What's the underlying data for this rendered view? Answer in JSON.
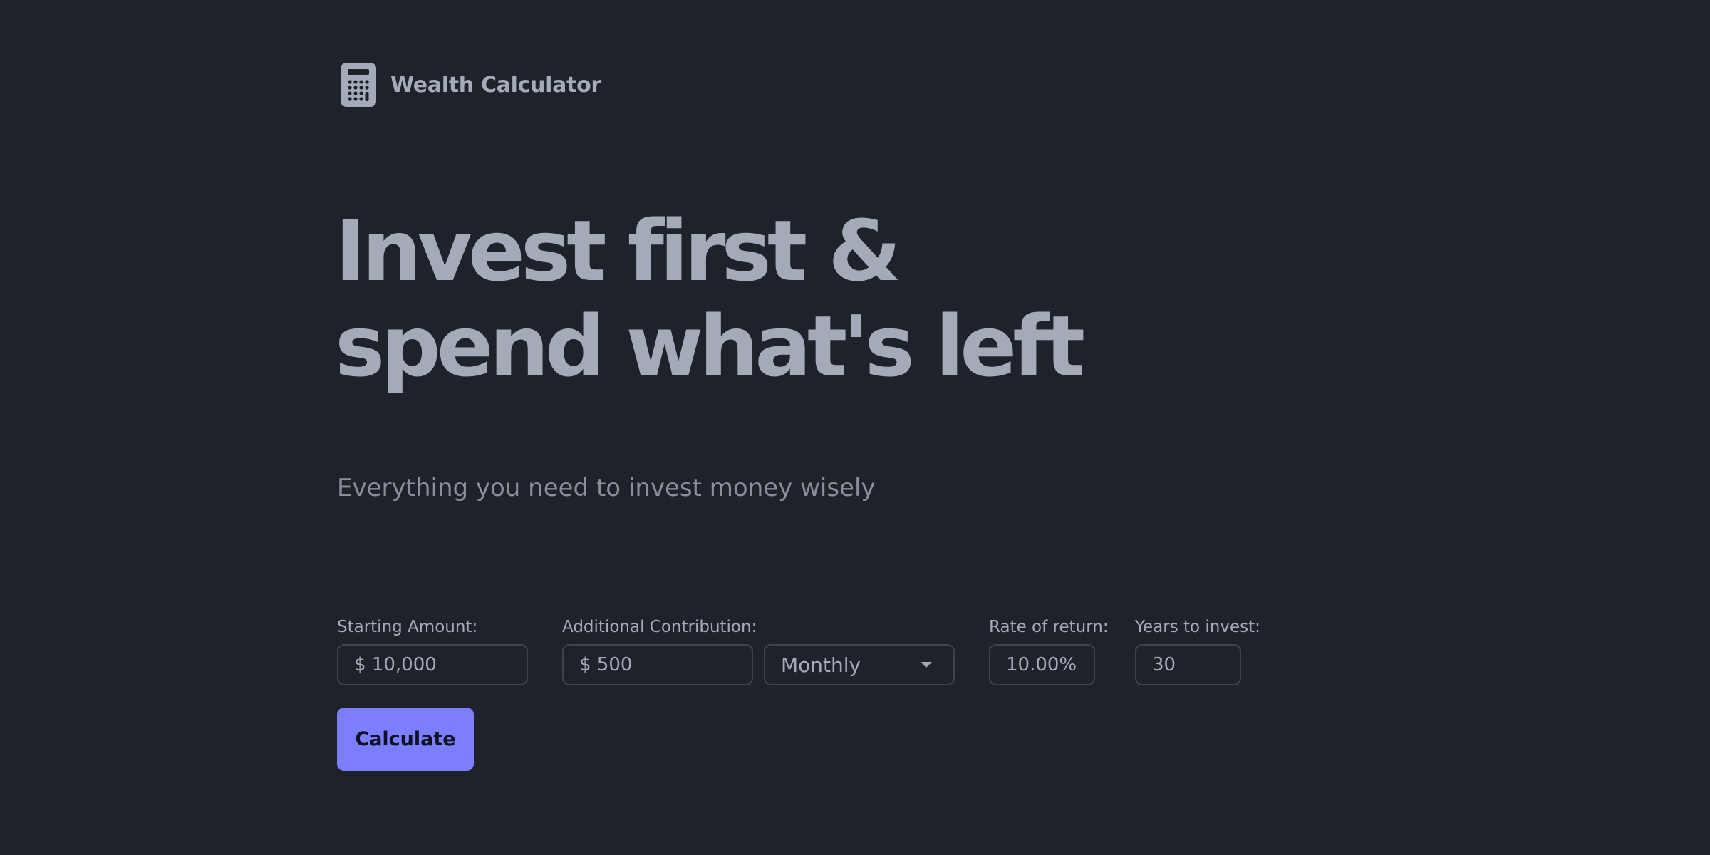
{
  "header": {
    "icon": "calculator-icon",
    "app_name": "Wealth Calculator"
  },
  "hero": {
    "headline_line1": "Invest first &",
    "headline_line2": "spend what's left",
    "subtitle": "Everything you need to invest money wisely"
  },
  "form": {
    "starting_amount": {
      "label": "Starting Amount:",
      "value": "$ 10,000"
    },
    "additional_contribution": {
      "label": "Additional Contribution:",
      "value": "$ 500"
    },
    "frequency": {
      "value": "Monthly",
      "icon": "chevron-down-icon"
    },
    "rate_of_return": {
      "label": "Rate of return:",
      "value": "10.00%"
    },
    "years_to_invest": {
      "label": "Years to invest:",
      "value": "30"
    },
    "submit_label": "Calculate"
  },
  "colors": {
    "background": "#1e222a",
    "text": "#a5aab8",
    "input_border": "#3d424d",
    "accent": "#7b7ffe"
  }
}
